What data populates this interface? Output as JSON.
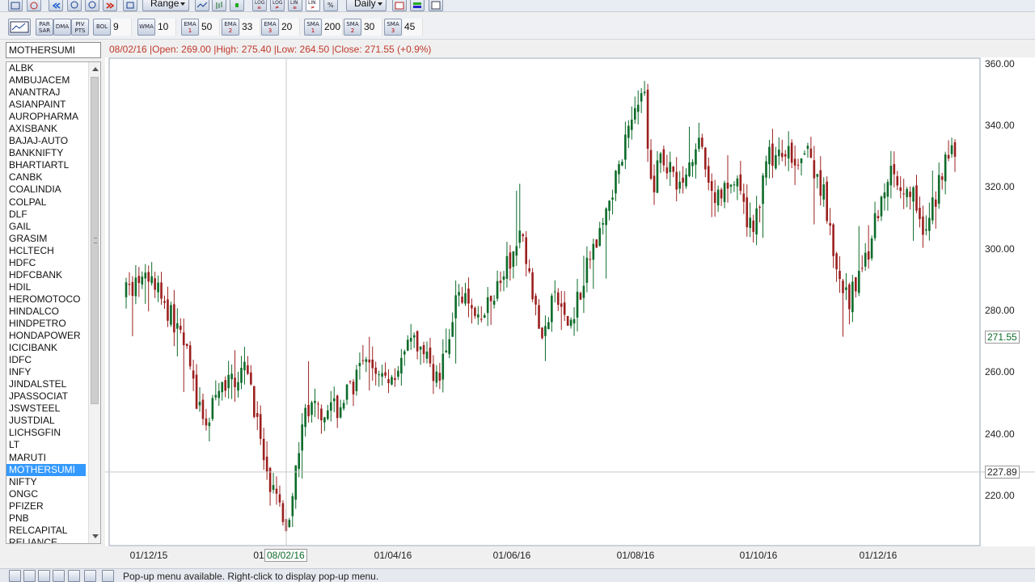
{
  "toolbar_top": {
    "range_label": "Range",
    "interval_label": "Daily",
    "log_buttons": [
      {
        "top": "LOG",
        "sub": "≡"
      },
      {
        "top": "LOG",
        "sub": "≠"
      },
      {
        "top": "LIN",
        "sub": "≡"
      },
      {
        "top": "LIN",
        "sub": "≠"
      },
      {
        "top": "%",
        "sub": ""
      }
    ]
  },
  "toolbar_indicators": {
    "par_sar": {
      "l1": "PAR",
      "l2": "SAR"
    },
    "dma": "DMA",
    "piv_pts": {
      "l1": "PIV",
      "l2": "PTS"
    },
    "bol": {
      "label": "BOL",
      "value": "9"
    },
    "wma": {
      "label": "WMA",
      "value": "10"
    },
    "ema": [
      {
        "label": "EMA",
        "n": "1",
        "value": "50"
      },
      {
        "label": "EMA",
        "n": "2",
        "value": "33"
      },
      {
        "label": "EMA",
        "n": "3",
        "value": "20"
      }
    ],
    "sma": [
      {
        "label": "SMA",
        "n": "1",
        "value": "200"
      },
      {
        "label": "SMA",
        "n": "2",
        "value": "30"
      },
      {
        "label": "SMA",
        "n": "3",
        "value": "45"
      }
    ]
  },
  "symbol": {
    "current": "MOTHERSUMI",
    "list": [
      "ALBK",
      "AMBUJACEM",
      "ANANTRAJ",
      "ASIANPAINT",
      "AUROPHARMA",
      "AXISBANK",
      "BAJAJ-AUTO",
      "BANKNIFTY",
      "BHARTIARTL",
      "CANBK",
      "COALINDIA",
      "COLPAL",
      "DLF",
      "GAIL",
      "GRASIM",
      "HCLTECH",
      "HDFC",
      "HDFCBANK",
      "HDIL",
      "HEROMOTOCO",
      "HINDALCO",
      "HINDPETRO",
      "HONDAPOWER",
      "ICICIBANK",
      "IDFC",
      "INFY",
      "JINDALSTEL",
      "JPASSOCIAT",
      "JSWSTEEL",
      "JUSTDIAL",
      "LICHSGFIN",
      "LT",
      "MARUTI",
      "MOTHERSUMI",
      "NIFTY",
      "ONGC",
      "PFIZER",
      "PNB",
      "RELCAPITAL",
      "RELIANCE"
    ],
    "selected_index": 33
  },
  "ohlc_text": "08/02/16 |Open: 269.00 |High: 275.40 |Low: 264.50 |Close: 271.55 (+0.9%)",
  "crosshair": {
    "date_label": "08/02/16",
    "price_label": "227.89"
  },
  "last_price_label": "271.55",
  "colors": {
    "up": "#0d6b2a",
    "down": "#9c1f1f",
    "ohlc_text": "#c0392b",
    "selection": "#3399ff"
  },
  "chart_data": {
    "type": "candlestick",
    "symbol": "MOTHERSUMI",
    "interval": "Daily",
    "y_ticks": [
      "360.00",
      "340.00",
      "320.00",
      "300.00",
      "280.00",
      "260.00",
      "240.00",
      "220.00"
    ],
    "ylim": [
      204,
      362
    ],
    "x_tick_labels": [
      "01/12/15",
      "01",
      "01/04/16",
      "01/06/16",
      "01/08/16",
      "01/10/16",
      "01/12/16"
    ],
    "trend_anchors": [
      {
        "i": 0,
        "price": 286
      },
      {
        "i": 8,
        "price": 290
      },
      {
        "i": 18,
        "price": 270
      },
      {
        "i": 24,
        "price": 242
      },
      {
        "i": 30,
        "price": 255
      },
      {
        "i": 38,
        "price": 262
      },
      {
        "i": 44,
        "price": 225
      },
      {
        "i": 50,
        "price": 210
      },
      {
        "i": 56,
        "price": 248
      },
      {
        "i": 66,
        "price": 248
      },
      {
        "i": 74,
        "price": 262
      },
      {
        "i": 82,
        "price": 258
      },
      {
        "i": 90,
        "price": 270
      },
      {
        "i": 98,
        "price": 258
      },
      {
        "i": 104,
        "price": 288
      },
      {
        "i": 110,
        "price": 275
      },
      {
        "i": 118,
        "price": 292
      },
      {
        "i": 124,
        "price": 305
      },
      {
        "i": 130,
        "price": 270
      },
      {
        "i": 134,
        "price": 285
      },
      {
        "i": 138,
        "price": 275
      },
      {
        "i": 146,
        "price": 300
      },
      {
        "i": 152,
        "price": 318
      },
      {
        "i": 158,
        "price": 345
      },
      {
        "i": 162,
        "price": 350
      },
      {
        "i": 164,
        "price": 320
      },
      {
        "i": 168,
        "price": 330
      },
      {
        "i": 174,
        "price": 320
      },
      {
        "i": 178,
        "price": 336
      },
      {
        "i": 184,
        "price": 316
      },
      {
        "i": 190,
        "price": 322
      },
      {
        "i": 196,
        "price": 305
      },
      {
        "i": 200,
        "price": 330
      },
      {
        "i": 206,
        "price": 330
      },
      {
        "i": 212,
        "price": 332
      },
      {
        "i": 218,
        "price": 318
      },
      {
        "i": 222,
        "price": 290
      },
      {
        "i": 226,
        "price": 283
      },
      {
        "i": 232,
        "price": 300
      },
      {
        "i": 238,
        "price": 325
      },
      {
        "i": 246,
        "price": 318
      },
      {
        "i": 250,
        "price": 305
      },
      {
        "i": 256,
        "price": 330
      },
      {
        "i": 259,
        "price": 331
      }
    ],
    "last_close": 271.55,
    "crosshair_close": 271.55
  },
  "status_text": "Pop-up menu available. Right-click to display pop-up menu."
}
